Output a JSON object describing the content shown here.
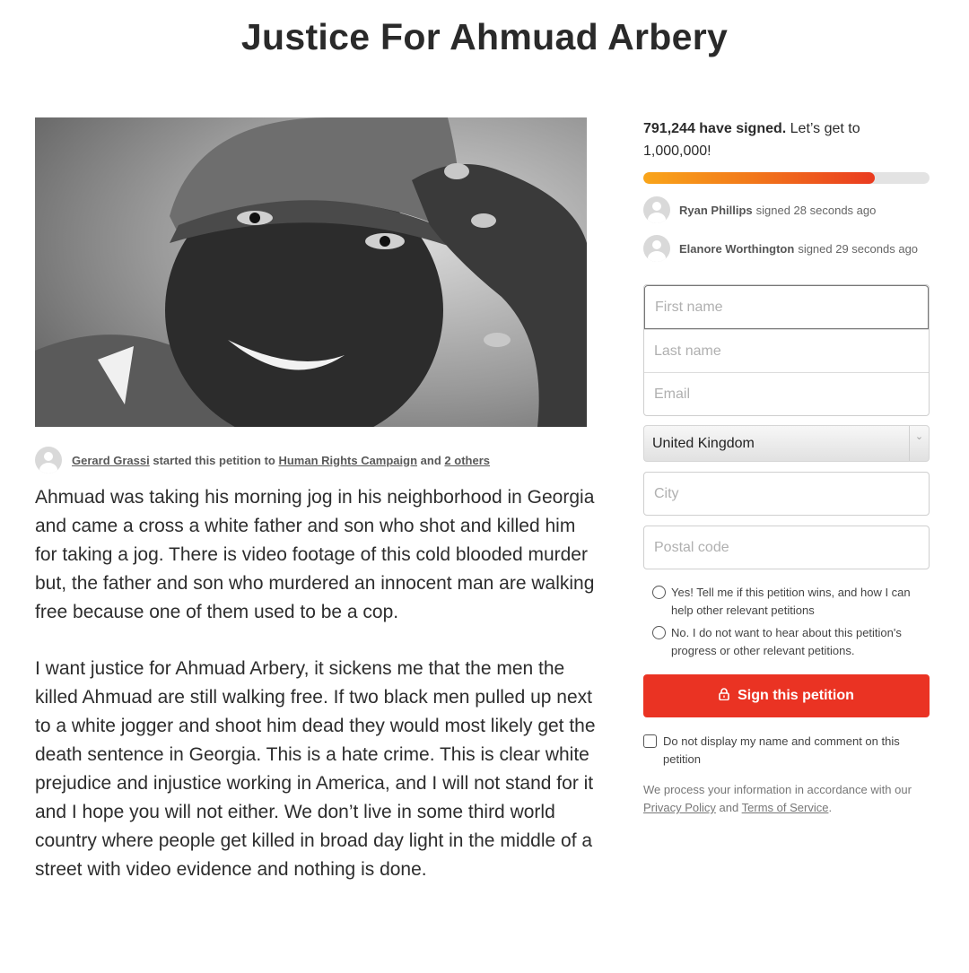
{
  "page": {
    "title": "Justice For Ahmuad Arbery"
  },
  "starter": {
    "name": "Gerard Grassi",
    "started_text": "started this petition to",
    "recipient": "Human Rights Campaign",
    "and_text": "and",
    "others": "2 others"
  },
  "story": {
    "paragraphs": [
      "Ahmuad was taking his morning jog in his neighborhood in Georgia and came a cross a white father and son who shot and killed him for taking a jog. There is video footage of this cold blooded murder but, the father and son who murdered an innocent man are walking free because one of them used to be a cop.",
      "I want justice for Ahmuad Arbery, it sickens me that the men the killed Ahmuad are still walking free. If two black men pulled up next to a white jogger and shoot him dead they would most likely get the death sentence in Georgia. This is a hate crime. This is clear white prejudice and injustice working in America, and I will not stand for it and I hope you will not either. We don’t live in some third world country where people get killed in broad day light in the middle of a street with video evidence and nothing is done."
    ]
  },
  "progress": {
    "count_bold": "791,244 have signed.",
    "goal_text": "Let’s get to 1,000,000!",
    "fraction": 0.81,
    "fill_color": "#ea3b20",
    "track_color": "#e3e3e3"
  },
  "recent_signers": [
    {
      "name": "Ryan Phillips",
      "ago": "signed 28 seconds ago"
    },
    {
      "name": "Elanore Worthington",
      "ago": "signed 29 seconds ago"
    }
  ],
  "form": {
    "first_name_placeholder": "First name",
    "last_name_placeholder": "Last name",
    "email_placeholder": "Email",
    "country_value": "United Kingdom",
    "city_placeholder": "City",
    "postal_placeholder": "Postal code",
    "opt_in_yes": "Yes! Tell me if this petition wins, and how I can help other relevant petitions",
    "opt_in_no": "No. I do not want to hear about this petition's progress or other relevant petitions.",
    "sign_button": "Sign this petition",
    "hide_name": "Do not display my name and comment on this petition",
    "privacy_prefix": "We process your information in accordance with our",
    "privacy_policy": "Privacy Policy",
    "privacy_and": "and",
    "terms": "Terms of Service",
    "privacy_suffix": "."
  },
  "colors": {
    "accent": "#ea3323",
    "text": "#2b2b2b"
  },
  "icons": {
    "lock": "lock-icon",
    "avatar": "user-avatar-icon",
    "chevron": "chevron-down-icon"
  }
}
